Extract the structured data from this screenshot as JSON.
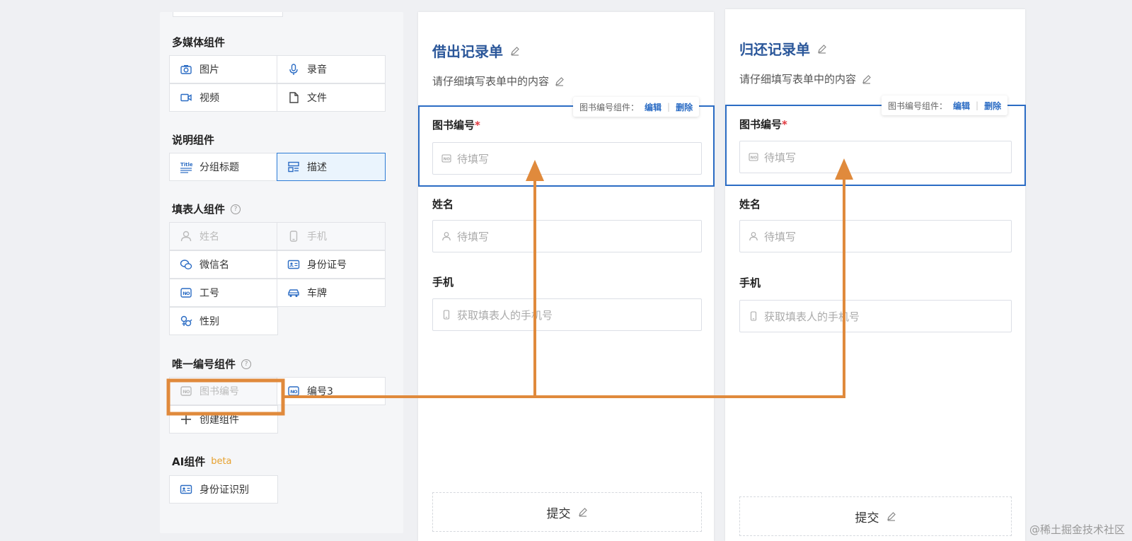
{
  "palette": {
    "sections": {
      "media": {
        "title": "多媒体组件",
        "items": [
          "图片",
          "录音",
          "视频",
          "文件"
        ]
      },
      "desc": {
        "title": "说明组件",
        "items": [
          "分组标题",
          "描述"
        ]
      },
      "filler": {
        "title": "填表人组件",
        "items": [
          "姓名",
          "手机",
          "微信名",
          "身份证号",
          "工号",
          "车牌",
          "性别"
        ]
      },
      "unique": {
        "title": "唯一编号组件",
        "items": [
          "图书编号",
          "编号3",
          "创建组件"
        ]
      },
      "ai": {
        "title": "AI组件",
        "badge": "beta",
        "items": [
          "身份证识别"
        ]
      }
    },
    "title_icon_text": "Title"
  },
  "forms": [
    {
      "title": "借出记录单",
      "description": "请仔细填写表单中的内容",
      "toolbar": {
        "label": "图书编号组件：",
        "edit": "编辑",
        "delete": "删除"
      },
      "fields": [
        {
          "label": "图书编号",
          "required": "*",
          "placeholder": "待填写"
        },
        {
          "label": "姓名",
          "placeholder": "待填写"
        },
        {
          "label": "手机",
          "placeholder": "获取填表人的手机号"
        }
      ],
      "submit": "提交"
    },
    {
      "title": "归还记录单",
      "description": "请仔细填写表单中的内容",
      "toolbar": {
        "label": "图书编号组件：",
        "edit": "编辑",
        "delete": "删除"
      },
      "fields": [
        {
          "label": "图书编号",
          "required": "*",
          "placeholder": "待填写"
        },
        {
          "label": "姓名",
          "placeholder": "待填写"
        },
        {
          "label": "手机",
          "placeholder": "获取填表人的手机号"
        }
      ],
      "submit": "提交"
    }
  ],
  "watermark": "@稀土掘金技术社区",
  "colors": {
    "accent": "#2b6cc4",
    "title": "#2b579a",
    "annotation": "#e08a3c",
    "beta": "#e7a12e",
    "required": "#e0383e"
  },
  "icons": {
    "media": [
      "camera-icon",
      "microphone-icon",
      "video-icon",
      "file-icon"
    ],
    "desc": [
      "title-icon",
      "layout-icon"
    ],
    "filler": [
      "user-icon",
      "phone-icon",
      "wechat-icon",
      "id-card-icon",
      "badge-no-icon",
      "car-icon",
      "gender-icon"
    ],
    "unique": [
      "badge-no-icon",
      "badge-no-icon",
      "plus-icon"
    ],
    "ai": [
      "id-card-icon"
    ]
  }
}
